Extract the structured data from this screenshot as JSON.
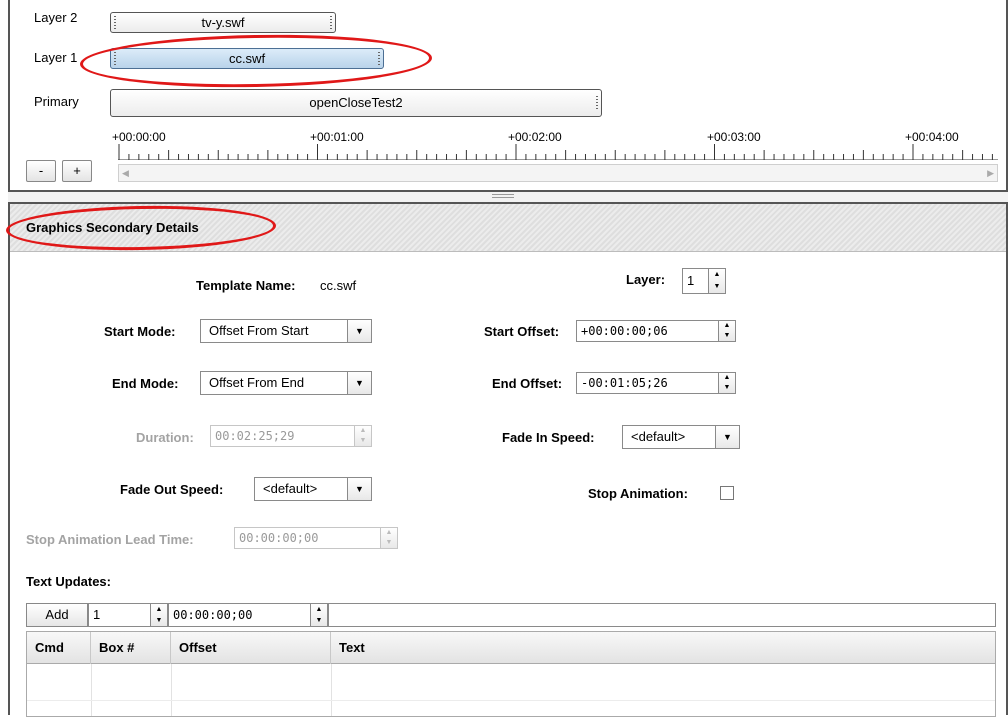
{
  "timeline": {
    "layers": [
      {
        "name": "Layer 2",
        "clip": "tv-y.swf"
      },
      {
        "name": "Layer 1",
        "clip": "cc.swf"
      },
      {
        "name": "Primary",
        "clip": "openCloseTest2"
      }
    ],
    "ticks": [
      "+00:00:00",
      "+00:01:00",
      "+00:02:00",
      "+00:03:00",
      "+00:04:00"
    ],
    "zoom_out_label": "-",
    "zoom_in_label": "+",
    "scroll_left": "◀",
    "scroll_right": "▶"
  },
  "details": {
    "header": "Graphics Secondary Details",
    "template_name_label": "Template Name:",
    "template_name": "cc.swf",
    "layer_label": "Layer:",
    "layer_value": "1",
    "start_mode_label": "Start Mode:",
    "start_mode_value": "Offset From Start",
    "start_offset_label": "Start Offset:",
    "start_offset_value": "+00:00:00;06",
    "end_mode_label": "End Mode:",
    "end_mode_value": "Offset From End",
    "end_offset_label": "End Offset:",
    "end_offset_value": "-00:01:05;26",
    "duration_label": "Duration:",
    "duration_value": "00:02:25;29",
    "fade_in_label": "Fade In Speed:",
    "fade_in_value": "<default>",
    "fade_out_label": "Fade Out Speed:",
    "fade_out_value": "<default>",
    "stop_animation_label": "Stop Animation:",
    "stop_animation_checked": false,
    "stop_lead_label": "Stop Animation Lead Time:",
    "stop_lead_value": "00:00:00;00",
    "text_updates_label": "Text Updates:",
    "add_label": "Add",
    "box_value": "1",
    "offset_value": "00:00:00;00",
    "text_value": "",
    "columns": [
      "Cmd",
      "Box #",
      "Offset",
      "Text"
    ]
  },
  "icons": {
    "dropdown": "▼",
    "spin_up": "▲",
    "spin_down": "▼"
  },
  "colors": {
    "highlight_ring": "#e01818",
    "selected_clip": "#b9d3ea"
  }
}
